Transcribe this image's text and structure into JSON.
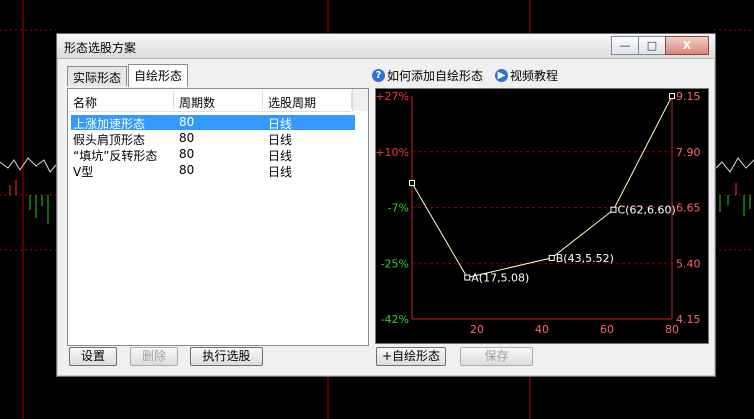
{
  "dialog": {
    "title": "形态选股方案",
    "win_minimize": "—",
    "win_maximize": "□",
    "win_close": "X"
  },
  "tabs": [
    {
      "label": "实际形态",
      "active": false
    },
    {
      "label": "自绘形态",
      "active": true
    }
  ],
  "list": {
    "headers": [
      "名称",
      "周期数",
      "选股周期"
    ],
    "rows": [
      {
        "name": "上涨加速形态",
        "period": "80",
        "cycle": "日线",
        "selected": true
      },
      {
        "name": "假头肩顶形态",
        "period": "80",
        "cycle": "日线",
        "selected": false
      },
      {
        "name": "“填坑”反转形态",
        "period": "80",
        "cycle": "日线",
        "selected": false
      },
      {
        "name": "V型",
        "period": "80",
        "cycle": "日线",
        "selected": false
      }
    ]
  },
  "buttons": {
    "settings": "设置",
    "delete": "删除",
    "run": "执行选股",
    "add": "+自绘形态",
    "save": "保存"
  },
  "links": {
    "how_to": "如何添加自绘形态",
    "video": "视频教程"
  },
  "colors": {
    "pct_pos": "#ff3333",
    "pct_neg": "#33cc33",
    "price": "#ff6666",
    "grid": "#8b0000",
    "line": "#ffffcc",
    "selected": "#3399ff"
  },
  "chart_data": {
    "type": "line",
    "x": [
      0,
      17,
      43,
      62,
      80
    ],
    "y": [
      7.2,
      5.08,
      5.52,
      6.6,
      9.15
    ],
    "xlim": [
      0,
      80
    ],
    "ylim": [
      4.15,
      9.15
    ],
    "xticks": [
      "20",
      "40",
      "60",
      "80"
    ],
    "left_ticks": [
      "+27%",
      "+10%",
      "-7%",
      "-25%",
      "-42%"
    ],
    "right_ticks": [
      "9.15",
      "7.90",
      "6.65",
      "5.40",
      "4.15"
    ],
    "annotations": [
      {
        "label": "A(17,5.08)",
        "index": 1
      },
      {
        "label": "B(43,5.52)",
        "index": 2
      },
      {
        "label": "C(62,6.60)",
        "index": 3
      }
    ]
  }
}
